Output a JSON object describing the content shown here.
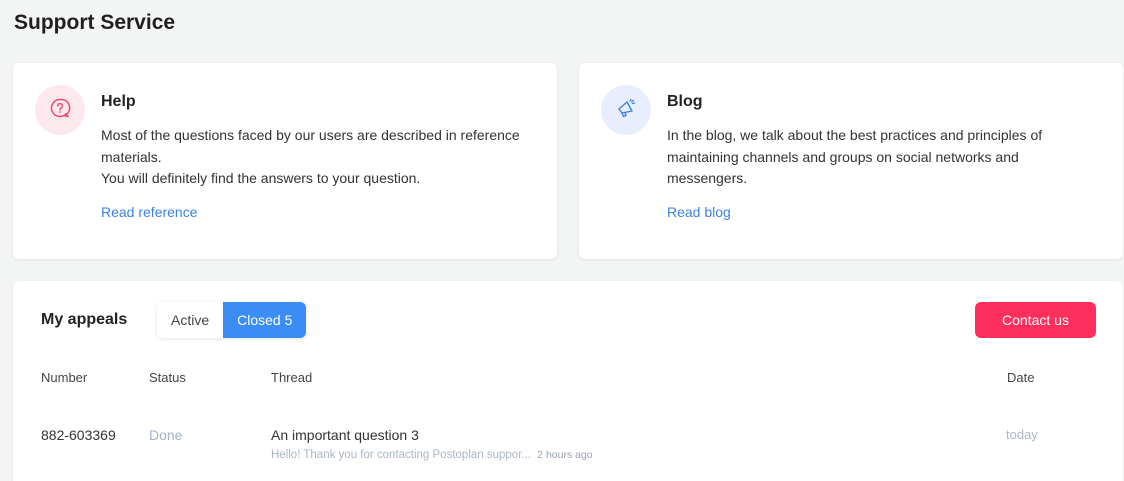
{
  "page": {
    "title": "Support Service"
  },
  "help": {
    "title": "Help",
    "text_lines": [
      "Most of the questions faced by our users are described in reference",
      "materials.",
      "You will definitely find the answers to your question."
    ],
    "link": "Read reference",
    "icon": "question-bubble-icon"
  },
  "blog": {
    "title": "Blog",
    "text_lines": [
      "In the blog, we talk about the best practices and principles of",
      "maintaining channels and groups on social networks and",
      "messengers."
    ],
    "link": "Read blog",
    "icon": "megaphone-icon"
  },
  "appeals": {
    "title": "My appeals",
    "tabs": {
      "active": "Active",
      "closed": "Closed 5"
    },
    "contact_button": "Contact us",
    "columns": {
      "number": "Number",
      "status": "Status",
      "thread": "Thread",
      "date": "Date"
    },
    "rows": [
      {
        "number": "882-603369",
        "status": "Done",
        "thread_title": "An important question 3",
        "thread_preview": "Hello! Thank you for contacting Postoplan suppor...",
        "thread_time": "2 hours ago",
        "date": "today"
      }
    ]
  },
  "colors": {
    "accent_blue": "#3b8cf3",
    "link_blue": "#3b82e6",
    "contact_red": "#fe2e5d",
    "help_icon_bg": "#fde8ee",
    "blog_icon_bg": "#e8eefd"
  }
}
